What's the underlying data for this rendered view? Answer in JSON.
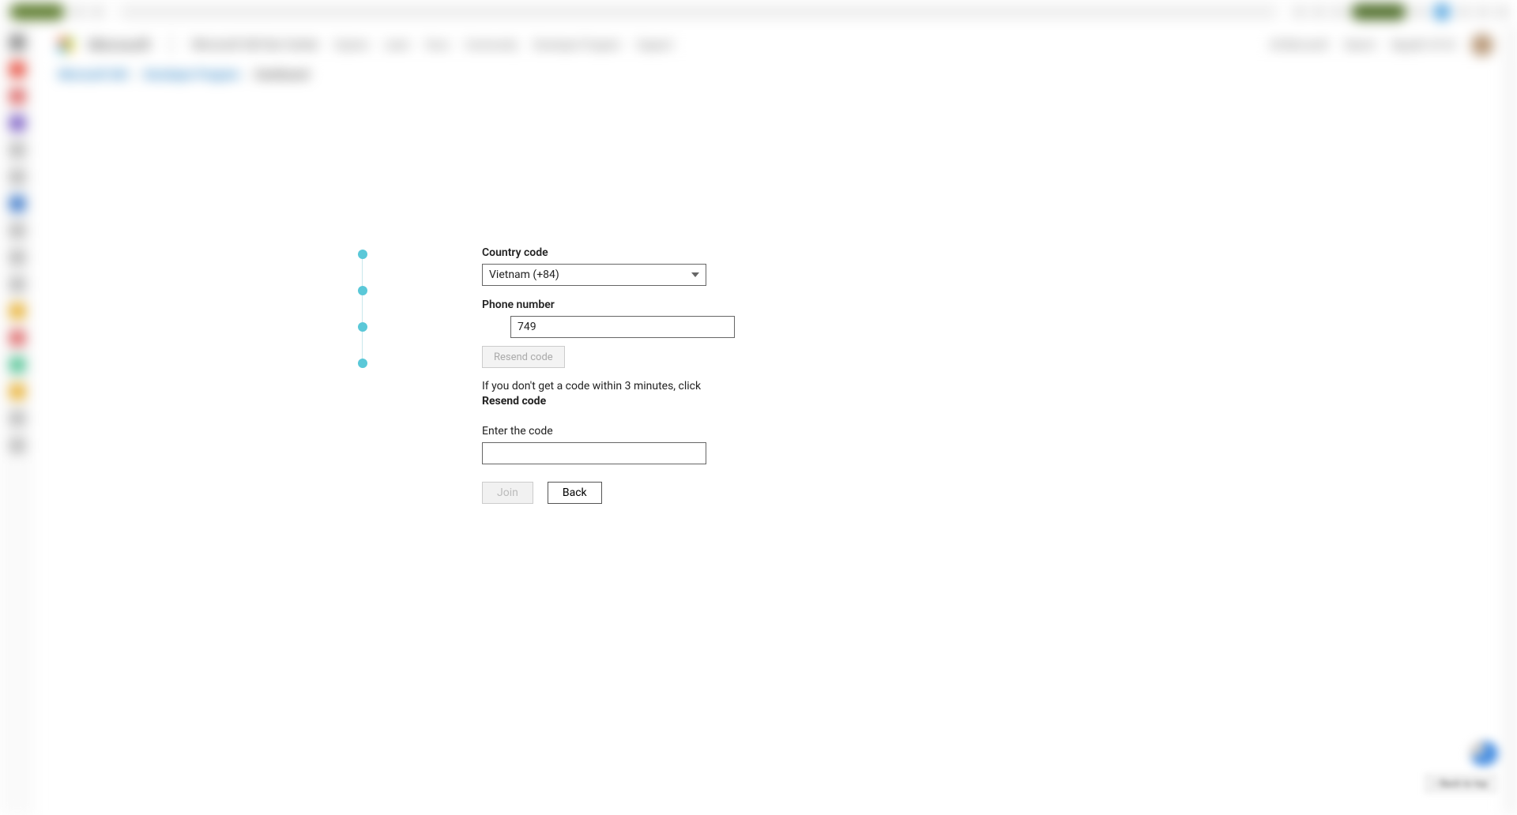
{
  "browser": {
    "url_hint": "https://developer.microsoft.com/..."
  },
  "header": {
    "brand": "Microsoft",
    "product": "Microsoft 365 Dev Center",
    "nav": [
      "Explore",
      "Learn",
      "Docs",
      "Community",
      "Developer Program",
      "Support"
    ],
    "right": [
      "All Microsoft",
      "Search",
      "Nguyễn Vũ Vũ"
    ]
  },
  "breadcrumb": {
    "items": [
      "Microsoft 365",
      "Developer Program",
      "Dashboard"
    ]
  },
  "form": {
    "country_code": {
      "label": "Country code",
      "selected": "Vietnam (+84)"
    },
    "phone": {
      "label": "Phone number",
      "value": "749"
    },
    "resend_button": "Resend code",
    "help": {
      "line1": "If you don't get a code within 3 minutes, click",
      "bold": "Resend code"
    },
    "code": {
      "label": "Enter the code",
      "value": ""
    },
    "buttons": {
      "join": "Join",
      "back": "Back"
    }
  },
  "footer": {
    "back_to_top": "↑ Back to top"
  }
}
